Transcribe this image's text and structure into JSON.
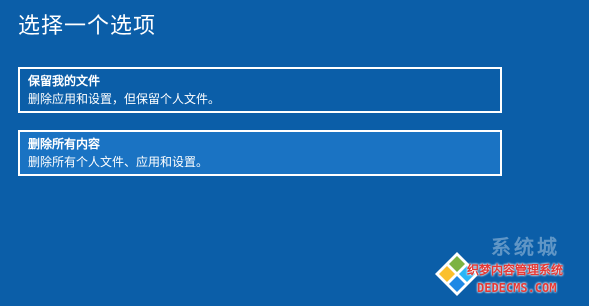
{
  "page": {
    "title": "选择一个选项"
  },
  "options": [
    {
      "title": "保留我的文件",
      "description": "删除应用和设置，但保留个人文件。"
    },
    {
      "title": "删除所有内容",
      "description": "删除所有个人文件、应用和设置。"
    }
  ],
  "watermark": {
    "brand": "系统城",
    "chinese_text": "织梦内容管理系统",
    "url": "DEDECMS.COM"
  },
  "colors": {
    "background": "#0b5ea8",
    "selected_option": "#1a73c3",
    "border": "#ffffff",
    "watermark_red": "#e53935"
  }
}
